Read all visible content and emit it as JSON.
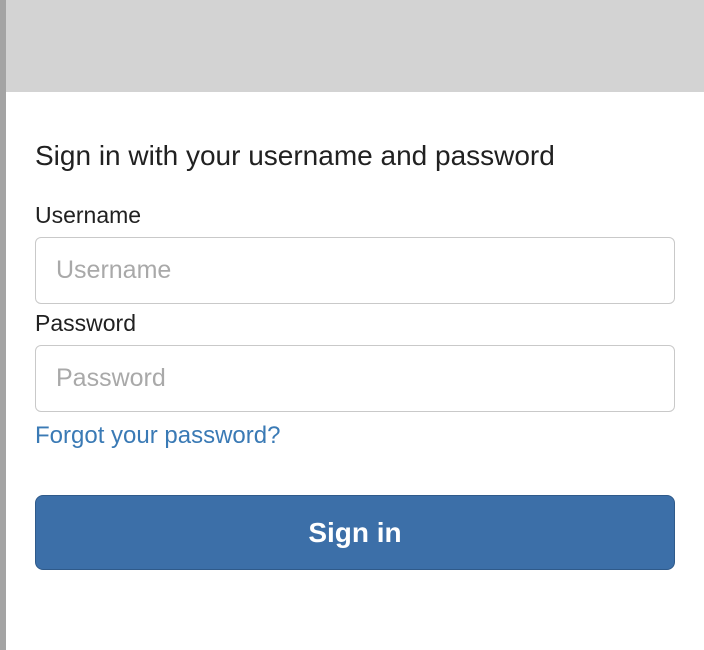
{
  "form": {
    "title": "Sign in with your username and password",
    "username_label": "Username",
    "username_placeholder": "Username",
    "password_label": "Password",
    "password_placeholder": "Password",
    "forgot_link": "Forgot your password?",
    "submit_label": "Sign in"
  }
}
